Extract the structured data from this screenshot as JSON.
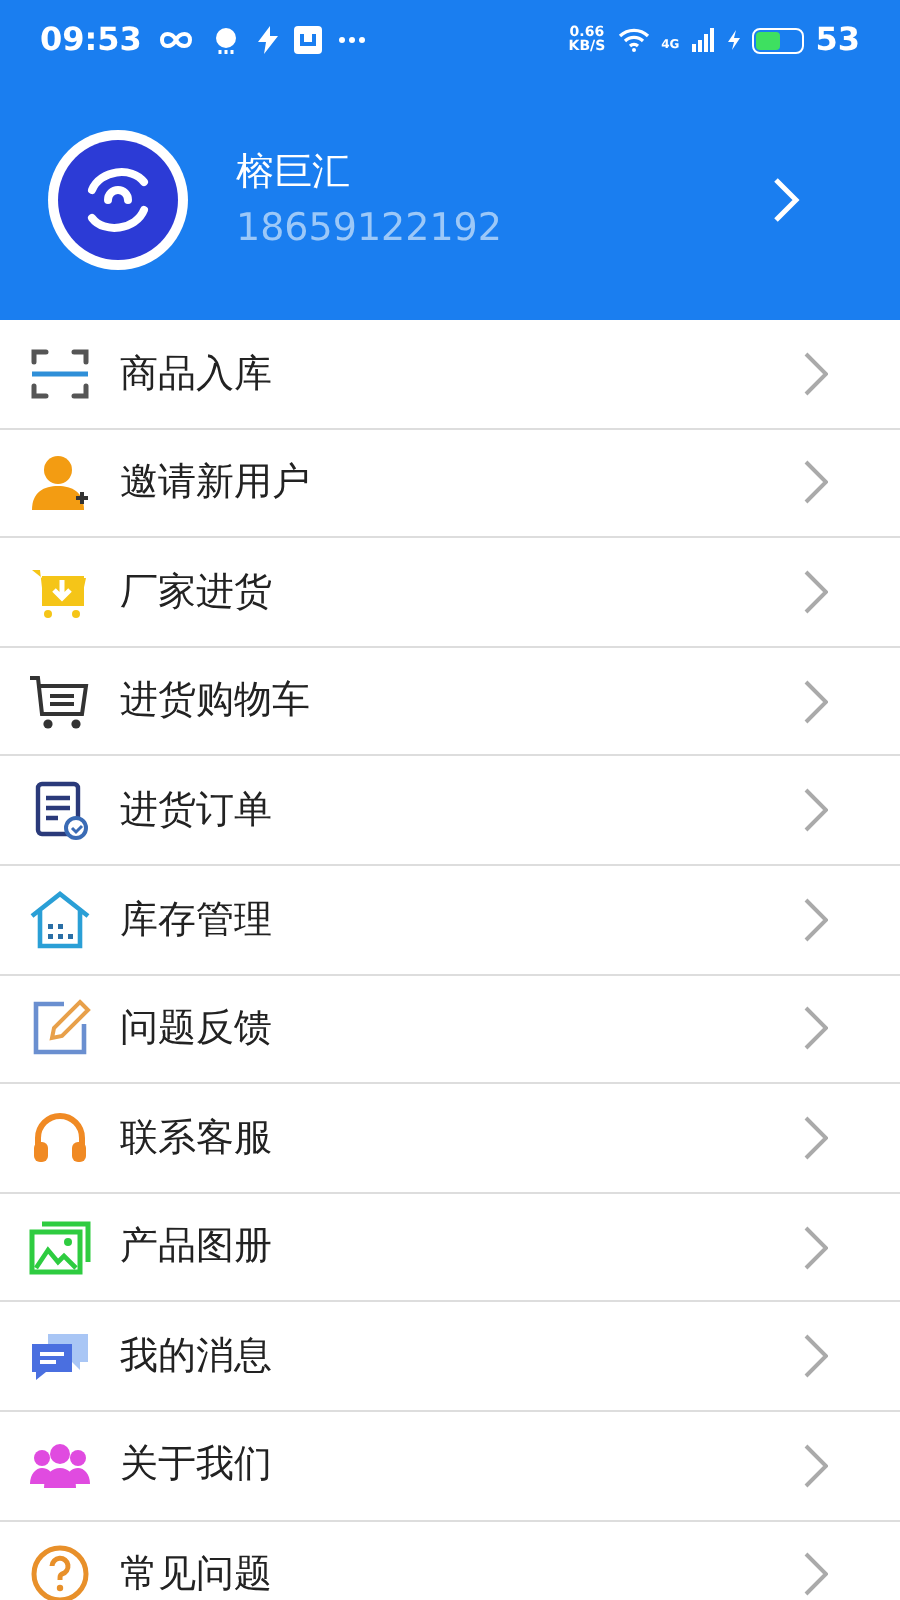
{
  "status_bar": {
    "time": "09:53",
    "speed": "0.66",
    "speed_unit": "KB/S",
    "network": "4G",
    "battery": "53"
  },
  "profile": {
    "name": "榕巨汇",
    "phone": "18659122192"
  },
  "menu": [
    {
      "label": "商品入库",
      "kind": "scan"
    },
    {
      "label": "邀请新用户",
      "kind": "invite"
    },
    {
      "label": "厂家进货",
      "kind": "factory"
    },
    {
      "label": "进货购物车",
      "kind": "cart"
    },
    {
      "label": "进货订单",
      "kind": "order"
    },
    {
      "label": "库存管理",
      "kind": "stock"
    },
    {
      "label": "问题反馈",
      "kind": "feedback"
    },
    {
      "label": "联系客服",
      "kind": "service"
    },
    {
      "label": "产品图册",
      "kind": "album"
    },
    {
      "label": "我的消息",
      "kind": "message"
    },
    {
      "label": "关于我们",
      "kind": "about"
    },
    {
      "label": "常见问题",
      "kind": "faq"
    }
  ]
}
